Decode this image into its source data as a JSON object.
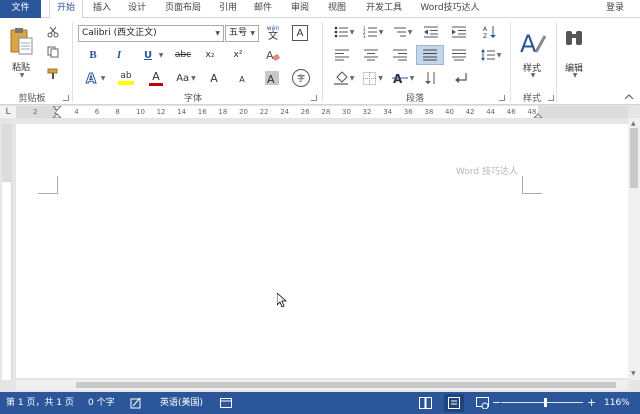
{
  "tabs": {
    "file": "文件",
    "items": [
      {
        "label": "开始",
        "active": true
      },
      {
        "label": "插入"
      },
      {
        "label": "设计"
      },
      {
        "label": "页面布局"
      },
      {
        "label": "引用"
      },
      {
        "label": "邮件"
      },
      {
        "label": "审阅"
      },
      {
        "label": "视图"
      },
      {
        "label": "开发工具"
      },
      {
        "label": "Word技巧达人"
      }
    ],
    "login": "登录"
  },
  "ribbon": {
    "clipboard": {
      "group_label": "剪贴板",
      "paste_label": "粘贴"
    },
    "font": {
      "group_label": "字体",
      "font_name": "Calibri (西文正文)",
      "font_size": "五号",
      "bold": "B",
      "italic": "I",
      "underline": "U",
      "strike": "abc",
      "subscript": "x₂",
      "superscript": "x²",
      "phonetic_top": "wén",
      "phonetic_bottom": "文",
      "border_char": "A",
      "highlight": "ab",
      "font_color": "A",
      "change_case": "Aa",
      "grow": "A",
      "shrink": "A",
      "enclose": "字"
    },
    "paragraph": {
      "group_label": "段落"
    },
    "styles": {
      "group_label": "样式",
      "label": "样式"
    },
    "editing": {
      "label": "编辑"
    }
  },
  "ruler": {
    "corner": "L",
    "marks": [
      "2",
      "2",
      "4",
      "6",
      "8",
      "10",
      "12",
      "14",
      "16",
      "18",
      "20",
      "22",
      "24",
      "26",
      "28",
      "30",
      "32",
      "34",
      "36",
      "38",
      "40",
      "42",
      "44",
      "46",
      "48"
    ]
  },
  "document": {
    "watermark": "Word 技巧达人"
  },
  "statusbar": {
    "page": "第 1 页，共 1 页",
    "words": "0 个字",
    "language": "英语(美国)",
    "zoom_minus": "−",
    "zoom_plus": "+",
    "zoom": "116%"
  },
  "colors": {
    "accent": "#2b579a",
    "highlight_bar": "#ffff00",
    "font_color_bar": "#c00000"
  }
}
